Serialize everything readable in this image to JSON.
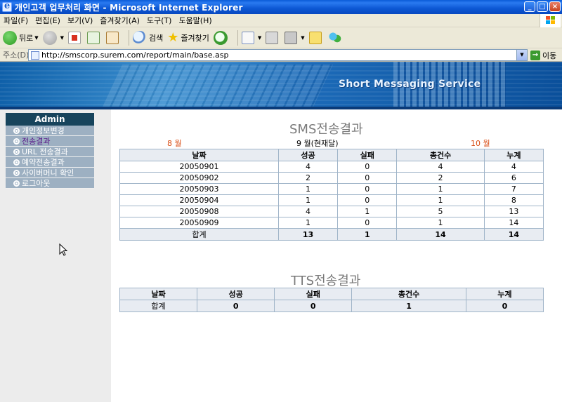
{
  "window": {
    "title": "개인고객 업무처리 화면 - Microsoft Internet Explorer",
    "buttons": {
      "minimize": "_",
      "maximize": "□",
      "close": "×"
    }
  },
  "menu": {
    "items": [
      {
        "label": "파일(F)"
      },
      {
        "label": "편집(E)"
      },
      {
        "label": "보기(V)"
      },
      {
        "label": "즐겨찾기(A)"
      },
      {
        "label": "도구(T)"
      },
      {
        "label": "도움말(H)"
      }
    ]
  },
  "toolbar": {
    "back_label": "뒤로",
    "search_label": "검색",
    "favorites_label": "즐겨찾기",
    "icons": [
      "back-icon",
      "forward-icon",
      "stop-icon",
      "refresh-icon",
      "home-icon",
      "search-icon",
      "favorites-star-icon",
      "history-icon",
      "mail-icon",
      "print-icon",
      "edit-icon",
      "folder-icon",
      "messenger-icon"
    ]
  },
  "address": {
    "label": "주소(D)",
    "url": "http://smscorp.surem.com/report/main/base.asp",
    "go_label": "이동"
  },
  "banner": {
    "slogan": "Short Messaging Service",
    "colors": {
      "primary": "#1c6ab8",
      "dark": "#0a3a78"
    }
  },
  "nav": {
    "header": "Admin",
    "items": [
      {
        "label": "개인정보변경"
      },
      {
        "label": "전송결과"
      },
      {
        "label": "URL 전송결과"
      },
      {
        "label": "예약전송결과"
      },
      {
        "label": "사이버머니 확인"
      },
      {
        "label": "로그아웃"
      }
    ],
    "active_index": 1,
    "colors": {
      "header_bg": "#17445c",
      "item_bg": "#9db0c2",
      "active_text": "#5a1a8a"
    }
  },
  "sms": {
    "title": "SMS전송결과",
    "prev_month": "8 월",
    "current_month": "9 월(현재달)",
    "next_month": "10 월",
    "headers": [
      "날짜",
      "성공",
      "실패",
      "총건수",
      "누계"
    ],
    "rows": [
      [
        "20050901",
        "4",
        "0",
        "4",
        "4"
      ],
      [
        "20050902",
        "2",
        "0",
        "2",
        "6"
      ],
      [
        "20050903",
        "1",
        "0",
        "1",
        "7"
      ],
      [
        "20050904",
        "1",
        "0",
        "1",
        "8"
      ],
      [
        "20050908",
        "4",
        "1",
        "5",
        "13"
      ],
      [
        "20050909",
        "1",
        "0",
        "1",
        "14"
      ]
    ],
    "total": [
      "합계",
      "13",
      "1",
      "14",
      "14"
    ]
  },
  "tts": {
    "title": "TTS전송결과",
    "headers": [
      "날짜",
      "성공",
      "실패",
      "총건수",
      "누계"
    ],
    "total": [
      "합계",
      "0",
      "0",
      "1",
      "0"
    ]
  }
}
